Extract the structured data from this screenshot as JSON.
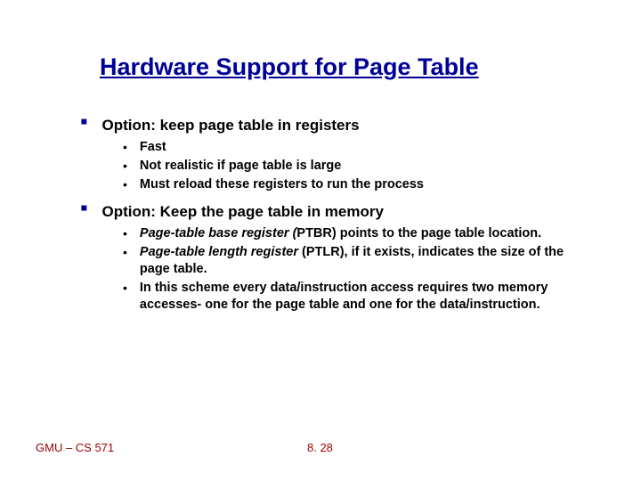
{
  "title": "Hardware Support for Page Table",
  "options": [
    {
      "heading": "Option: keep page table in registers",
      "subs": [
        {
          "text": "Fast"
        },
        {
          "text": "Not realistic if page table is large"
        },
        {
          "text": "Must reload these registers to run the process"
        }
      ]
    },
    {
      "heading": "Option: Keep the page table in memory",
      "subs": [
        {
          "prefix_italic": "Page-table base register (",
          "mid": "PTBR) points to the page table location."
        },
        {
          "prefix_italic": "Page-table length register",
          "mid": " (PTLR), if it exists,  indicates the size of the page table."
        },
        {
          "text": "In this scheme every data/instruction access requires two memory accesses- one for the page table and one for the data/instruction."
        }
      ]
    }
  ],
  "footer_left": "GMU – CS 571",
  "footer_center": "8. 28"
}
